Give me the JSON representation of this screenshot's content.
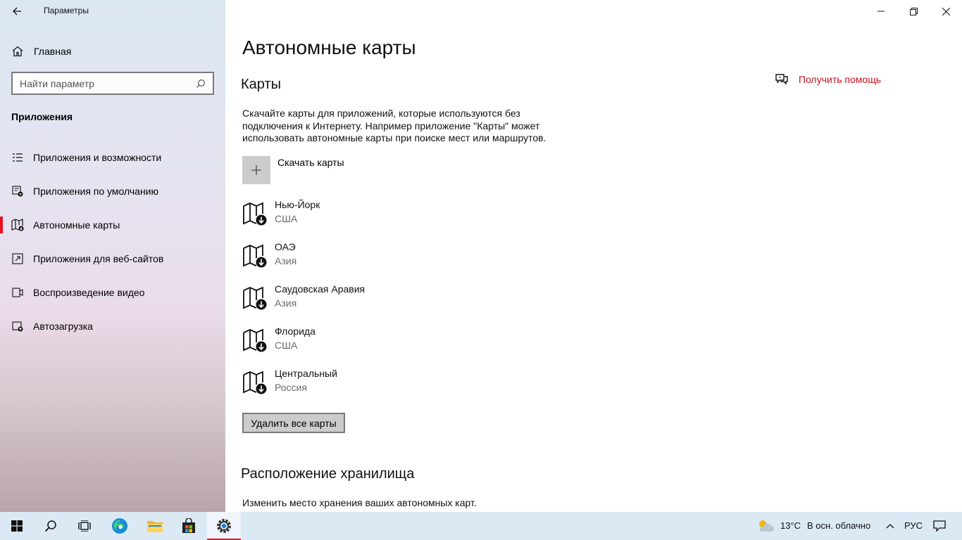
{
  "app": {
    "title": "Параметры"
  },
  "sidebar": {
    "home_label": "Главная",
    "search_placeholder": "Найти параметр",
    "section_title": "Приложения",
    "items": [
      {
        "label": "Приложения и возможности",
        "icon": "apps-list-icon"
      },
      {
        "label": "Приложения по умолчанию",
        "icon": "default-apps-icon"
      },
      {
        "label": "Автономные карты",
        "icon": "offline-maps-icon",
        "active": true
      },
      {
        "label": "Приложения для веб-сайтов",
        "icon": "web-apps-icon"
      },
      {
        "label": "Воспроизведение видео",
        "icon": "video-playback-icon"
      },
      {
        "label": "Автозагрузка",
        "icon": "startup-icon"
      }
    ]
  },
  "main": {
    "page_title": "Автономные карты",
    "maps_section_title": "Карты",
    "description": "Скачайте карты для приложений, которые используются без подключения к Интернету. Например приложение \"Карты\" может использовать автономные карты при поиске мест или маршрутов.",
    "download_label": "Скачать карты",
    "maps": [
      {
        "name": "Нью-Йорк",
        "region": "США"
      },
      {
        "name": "ОАЭ",
        "region": "Азия"
      },
      {
        "name": "Саудовская Аравия",
        "region": "Азия"
      },
      {
        "name": "Флорида",
        "region": "США"
      },
      {
        "name": "Центральный",
        "region": "Россия"
      }
    ],
    "delete_all_label": "Удалить все карты",
    "storage_section_title": "Расположение хранилища",
    "storage_description": "Изменить место хранения ваших автономных карт.",
    "help_label": "Получить помощь"
  },
  "taskbar": {
    "weather_temp": "13°C",
    "weather_desc": "В осн. облачно",
    "language": "РУС"
  },
  "colors": {
    "accent": "#e81123",
    "help_link": "#c50f1f",
    "sidebar_bg": "#e4e4f0",
    "taskbar_bg": "#dbe9f5"
  }
}
